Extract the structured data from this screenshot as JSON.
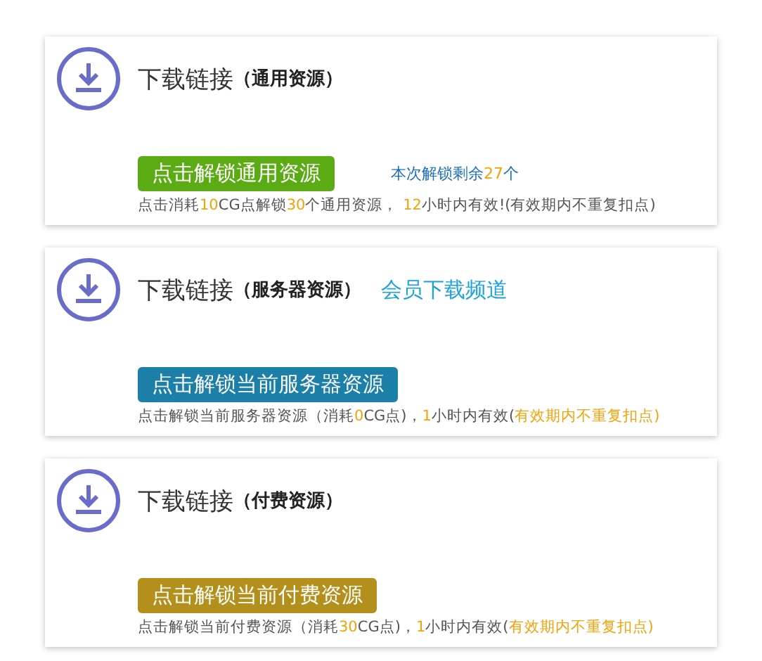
{
  "cards": [
    {
      "title": "下载链接",
      "subtitle": "（通用资源）",
      "button": {
        "label": "点击解锁通用资源",
        "color": "#5aab14"
      },
      "remaining": [
        {
          "text": "本次解锁剩余",
          "highlight": false
        },
        {
          "text": "27",
          "highlight": true
        },
        {
          "text": "个",
          "highlight": false
        }
      ],
      "note": [
        {
          "text": "点击消耗",
          "highlight": false
        },
        {
          "text": "10",
          "highlight": true
        },
        {
          "text": "CG点解锁",
          "highlight": false
        },
        {
          "text": "30",
          "highlight": true
        },
        {
          "text": "个通用资源， ",
          "highlight": false
        },
        {
          "text": "12",
          "highlight": true
        },
        {
          "text": "小时内有效!(有效期内不重复扣点)",
          "highlight": false
        }
      ]
    },
    {
      "title": "下载链接",
      "subtitle": "（服务器资源）",
      "link": "会员下载频道",
      "button": {
        "label": "点击解锁当前服务器资源",
        "color": "#1b7fa7"
      },
      "note": [
        {
          "text": "点击解锁当前服务器资源（消耗",
          "highlight": false
        },
        {
          "text": "0",
          "highlight": true
        },
        {
          "text": "CG点)，",
          "highlight": false
        },
        {
          "text": "1",
          "highlight": true
        },
        {
          "text": "小时内有效(",
          "highlight": false
        },
        {
          "text": "有效期内不重复扣点)",
          "highlight": true
        }
      ]
    },
    {
      "title": "下载链接",
      "subtitle": "（付费资源）",
      "button": {
        "label": "点击解锁当前付费资源",
        "color": "#b38f1c"
      },
      "note": [
        {
          "text": "点击解锁当前付费资源（消耗",
          "highlight": false
        },
        {
          "text": "30",
          "highlight": true
        },
        {
          "text": "CG点)，",
          "highlight": false
        },
        {
          "text": "1",
          "highlight": true
        },
        {
          "text": "小时内有效(",
          "highlight": false
        },
        {
          "text": "有效期内不重复扣点)",
          "highlight": true
        }
      ]
    }
  ]
}
